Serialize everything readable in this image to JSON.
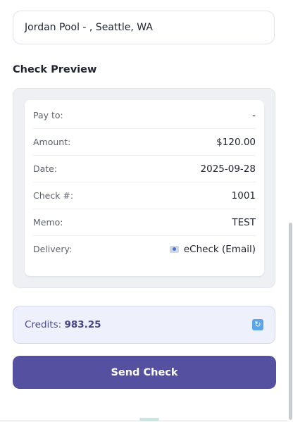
{
  "payee_field": {
    "value": "Jordan Pool - , Seattle, WA"
  },
  "check_preview": {
    "title": "Check Preview",
    "rows": [
      {
        "label": "Pay to:",
        "value": "-"
      },
      {
        "label": "Amount:",
        "value": "$120.00"
      },
      {
        "label": "Date:",
        "value": "2025-09-28"
      },
      {
        "label": "Check #:",
        "value": "1001"
      },
      {
        "label": "Memo:",
        "value": "TEST"
      },
      {
        "label": "Delivery:",
        "value": "eCheck (Email)",
        "icon": "email-icon"
      }
    ]
  },
  "credits": {
    "label": "Credits:",
    "amount": "983.25",
    "refresh_icon": "refresh-icon",
    "refresh_symbol": "↻"
  },
  "actions": {
    "send_label": "Send Check"
  },
  "colors": {
    "primary_button": "#5550a0",
    "credits_bg": "#eef0fb"
  }
}
